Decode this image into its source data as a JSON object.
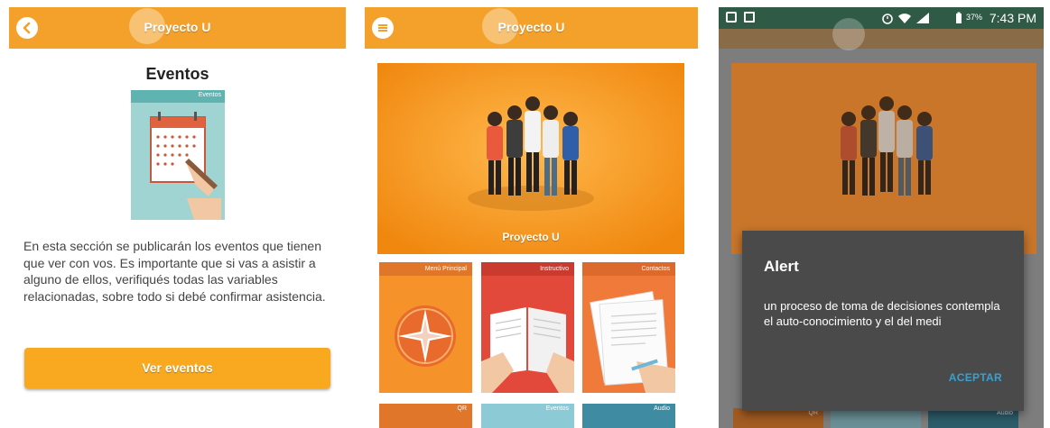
{
  "colors": {
    "primary": "#f4a12b",
    "button": "#f8a91f",
    "dialog_bg": "#4a4a4a",
    "dialog_action": "#3aa0cf",
    "statusbar": "#2f5a46"
  },
  "screen1": {
    "app_title": "Proyecto U",
    "back_icon": "chevron-left-icon",
    "section_title": "Eventos",
    "illustration_label": "Eventos",
    "paragraph": "En esta sección se publicarán los eventos que tienen que ver con vos. Es importante que si vas a asistir a alguno de ellos, verifiqués todas las variables relacionadas, sobre todo si debé confirmar asistencia.",
    "button_label": "Ver eventos"
  },
  "screen2": {
    "app_title": "Proyecto U",
    "menu_icon": "menu-icon",
    "hero_label": "Proyecto U",
    "tiles": [
      {
        "label": "Menú Principal"
      },
      {
        "label": "Instructivo"
      },
      {
        "label": "Contactos"
      }
    ],
    "bottom_tiles": [
      {
        "label": "QR"
      },
      {
        "label": "Eventos"
      },
      {
        "label": "Audio"
      }
    ]
  },
  "screen3": {
    "status": {
      "battery": "37%",
      "time": "7:43 PM"
    },
    "dialog": {
      "title": "Alert",
      "message": "un proceso de toma de decisiones contempla el auto-conocimiento y el del medi",
      "action": "ACEPTAR"
    },
    "bottom_tiles": [
      {
        "label": "QR"
      },
      {
        "label": "Audio"
      }
    ]
  }
}
